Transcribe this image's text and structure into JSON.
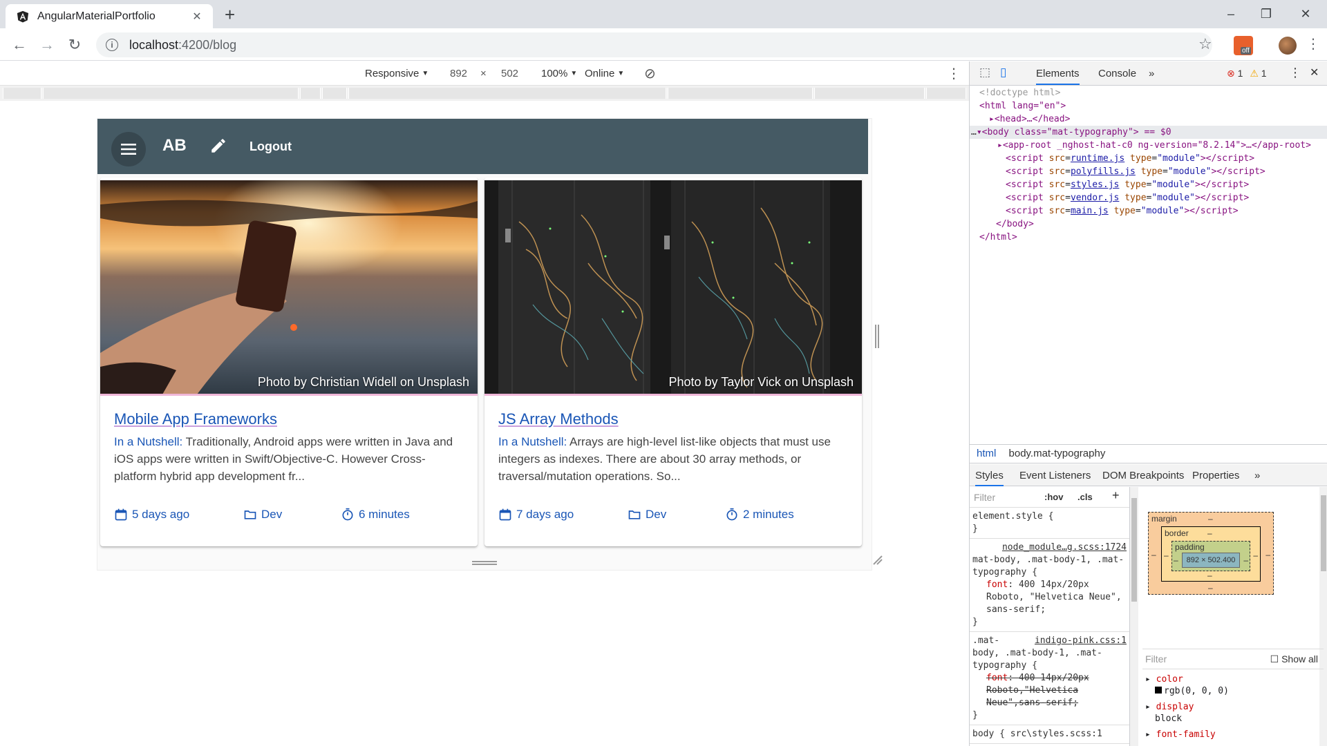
{
  "browser": {
    "tab_title": "AngularMaterialPortfolio",
    "tab_close": "✕",
    "new_tab": "+",
    "url_host": "localhost",
    "url_path": ":4200/blog",
    "window_controls": [
      "–",
      "❐",
      "✕"
    ],
    "extension_badge": "off"
  },
  "device_toolbar": {
    "mode": "Responsive",
    "width": "892",
    "times": "×",
    "height": "502",
    "zoom": "100%",
    "network": "Online"
  },
  "app": {
    "title": "AB",
    "logout_label": "Logout",
    "cards": [
      {
        "photo_credit": "Photo by Christian Widell on Unsplash",
        "title": "Mobile App Frameworks",
        "lead": "In a Nutshell:",
        "text": " Traditionally, Android apps were written in Java and iOS apps were written in Swift/Objective-C. However Cross-platform hybrid app development fr...",
        "date": "5 days ago",
        "category": "Dev",
        "read_time": "6 minutes"
      },
      {
        "photo_credit": "Photo by Taylor Vick on Unsplash",
        "title": "JS Array Methods",
        "lead": "In a Nutshell:",
        "text": " Arrays are high-level list-like objects that must use integers as indexes. There are about 30 array methods, or traversal/mutation operations. So...",
        "date": "7 days ago",
        "category": "Dev",
        "read_time": "2 minutes"
      }
    ]
  },
  "devtools": {
    "tabs": [
      "Elements",
      "Console",
      "»"
    ],
    "errors": "1",
    "warnings": "1",
    "dom": {
      "doctype": "<!doctype html>",
      "html_open": "<html lang=\"en\">",
      "head": "<head>…</head>",
      "body_open": "<body class=\"mat-typography\"> == $0",
      "app_root": "<app-root _nghost-hat-c0 ng-version=\"8.2.14\">…</app-root>",
      "scripts": [
        "runtime.js",
        "polyfills.js",
        "styles.js",
        "vendor.js",
        "main.js"
      ],
      "body_close": "</body>",
      "html_close": "</html>"
    },
    "breadcrumbs": [
      "html",
      "body.mat-typography"
    ],
    "sub_tabs": [
      "Styles",
      "Event Listeners",
      "DOM Breakpoints",
      "Properties",
      "»"
    ],
    "filter_placeholder": "Filter",
    "hov": ":hov",
    "cls": ".cls",
    "rules": {
      "element_style": "element.style {",
      "rule1_source": "node_module…g.scss:1724",
      "rule1_selector": "mat-body, .mat-body-1, .mat-typography {",
      "rule1_prop": "font",
      "rule1_value": "400 14px/20px Roboto, \"Helvetica Neue\", sans-serif;",
      "rule2_prefix": ".mat-",
      "rule2_source": "indigo-pink.css:1",
      "rule2_selector": "body, .mat-body-1, .mat-typography {",
      "rule2_prop": "font",
      "rule2_value": "400 14px/20px Roboto,\"Helvetica Neue\",sans-serif;",
      "rule3": "body {   src\\styles.scss:1"
    },
    "box_model": {
      "margin": "margin",
      "border": "border",
      "padding": "padding",
      "content": "892 × 502.400",
      "dash": "–"
    },
    "computed": {
      "filter": "Filter",
      "show_all": "Show all",
      "props": [
        {
          "name": "color",
          "value": "rgb(0, 0, 0)"
        },
        {
          "name": "display",
          "value": "block"
        },
        {
          "name": "font-family",
          "value": ""
        }
      ]
    }
  }
}
